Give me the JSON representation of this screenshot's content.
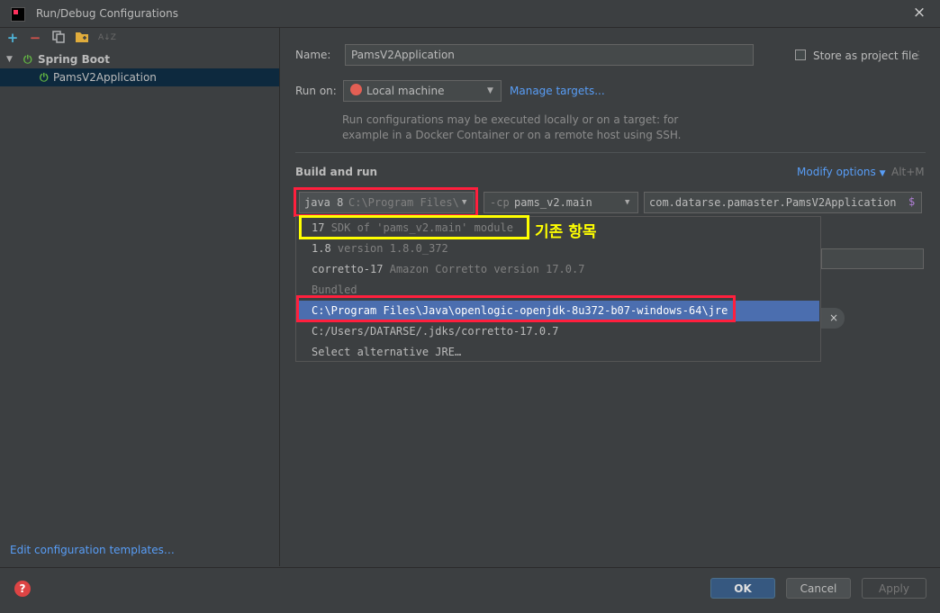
{
  "window": {
    "title": "Run/Debug Configurations",
    "close_icon": "×"
  },
  "toolbar": {
    "add": "+",
    "remove": "−",
    "sort": "A↓Z"
  },
  "tree": {
    "group": "Spring Boot",
    "selected": "PamsV2Application"
  },
  "sidebar": {
    "edit_templates": "Edit configuration templates…"
  },
  "form": {
    "name_label": "Name:",
    "name_value": "PamsV2Application",
    "store_label": "Store as project file",
    "runon_label": "Run on:",
    "runon_value": "Local machine",
    "manage_targets": "Manage targets...",
    "hint_line1": "Run configurations may be executed locally or on a target: for",
    "hint_line2": "example in a Docker Container or on a remote host using SSH.",
    "section_title": "Build and run",
    "modify_options": "Modify options",
    "modify_shortcut": "Alt+M",
    "jre_prefix": "java 8",
    "jre_path": "C:\\Program Files\\",
    "cp_prefix": "-cp",
    "cp_value": "pams_v2.main",
    "main_class": "com.datarse.pamaster.PamsV2Application",
    "main_class_icon": "$"
  },
  "popup": {
    "items": [
      {
        "main": "17",
        "sub": "SDK of 'pams_v2.main' module"
      },
      {
        "main": "1.8",
        "sub": "version 1.8.0_372"
      },
      {
        "main": "corretto-17",
        "sub": "Amazon Corretto version 17.0.7"
      },
      {
        "main": "Bundled",
        "sub": ""
      },
      {
        "main": "C:\\Program Files\\Java\\openlogic-openjdk-8u372-b07-windows-64\\jre",
        "sub": ""
      },
      {
        "main": "C:/Users/DATARSE/.jdks/corretto-17.0.7",
        "sub": ""
      },
      {
        "main": "Select alternative JRE…",
        "sub": ""
      }
    ]
  },
  "annotation": {
    "text": "기존 항목",
    "color": "#ffff00",
    "highlight_red": "#ff1f3d"
  },
  "footer": {
    "ok": "OK",
    "cancel": "Cancel",
    "apply": "Apply",
    "help_icon": "?"
  },
  "colors": {
    "accent": "#4b6eaf",
    "link": "#589df6",
    "power": "#62b543",
    "background": "#3c3f41"
  }
}
